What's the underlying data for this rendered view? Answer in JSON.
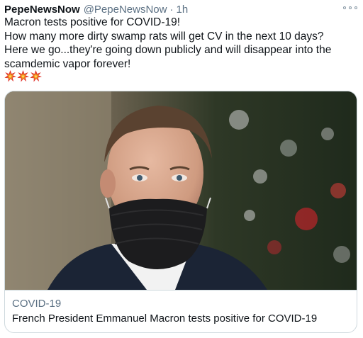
{
  "tweet": {
    "display_name": "PepeNewsNow",
    "handle": "@PepeNewsNow",
    "separator": "·",
    "time": "1h",
    "text_lines": [
      "Macron tests positive for COVID-19!",
      "How many more dirty swamp rats will get CV in the next 10 days?",
      "Here we go...they're going down publicly and will disappear into the",
      "scamdemic vapor forever!"
    ],
    "emojis": [
      "collision-emoji",
      "collision-emoji",
      "collision-emoji"
    ],
    "more_icon": "more-options-icon"
  },
  "card": {
    "image_icon": "news-photo",
    "domain": "COVID-19",
    "title": "French President Emmanuel Macron tests positive for COVID-19"
  },
  "colors": {
    "text_primary": "#0f1419",
    "text_secondary": "#5b7083",
    "border": "#cfd9de",
    "emoji_red": "#e0342c",
    "emoji_orange": "#f29c1f"
  }
}
